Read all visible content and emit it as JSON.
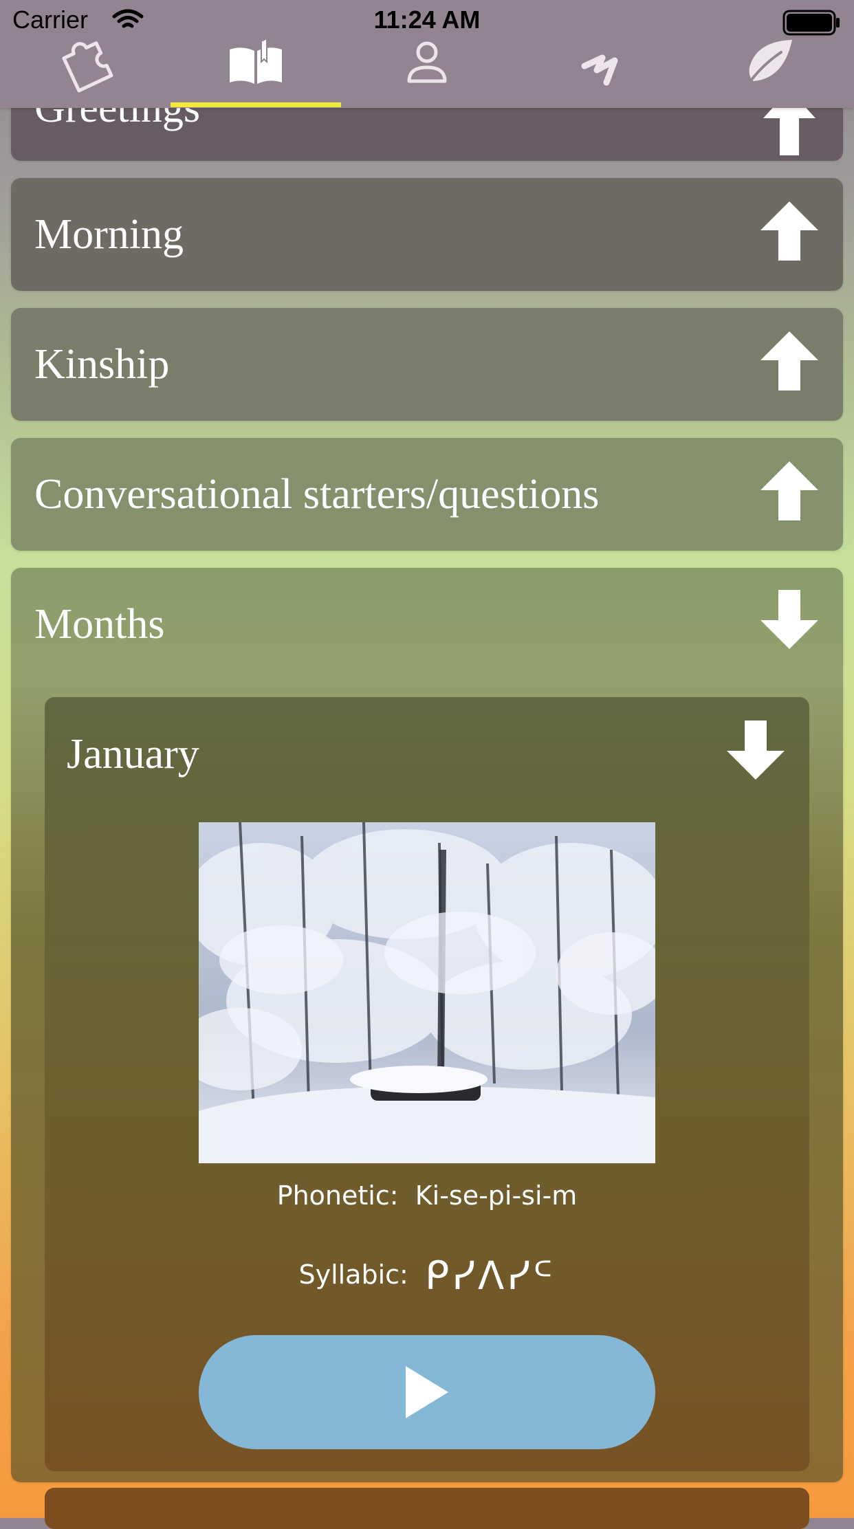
{
  "status_bar": {
    "carrier": "Carrier",
    "time": "11:24 AM"
  },
  "tabs": [
    {
      "icon": "puzzle-icon",
      "active": false
    },
    {
      "icon": "book-icon",
      "active": true
    },
    {
      "icon": "person-icon",
      "active": false
    },
    {
      "icon": "lightning-icon",
      "active": false
    },
    {
      "icon": "leaf-icon",
      "active": false
    }
  ],
  "colors": {
    "tab_indicator": "#f0ea3a",
    "play_button": "#85b8d6",
    "topbar": "#938491"
  },
  "categories": [
    {
      "label": "Greetings",
      "expanded": false
    },
    {
      "label": "Morning",
      "expanded": false
    },
    {
      "label": "Kinship",
      "expanded": false
    },
    {
      "label": "Conversational starters/questions",
      "expanded": false
    },
    {
      "label": "Months",
      "expanded": true
    }
  ],
  "month_item": {
    "label": "January",
    "expanded": true,
    "phonetic_label": "Phonetic:",
    "phonetic_value": "Ki-se-pi-si-m",
    "syllabic_label": "Syllabic:",
    "syllabic_value": "ᑭᓯᐱᓯᒼ",
    "play_icon": "play-icon"
  }
}
